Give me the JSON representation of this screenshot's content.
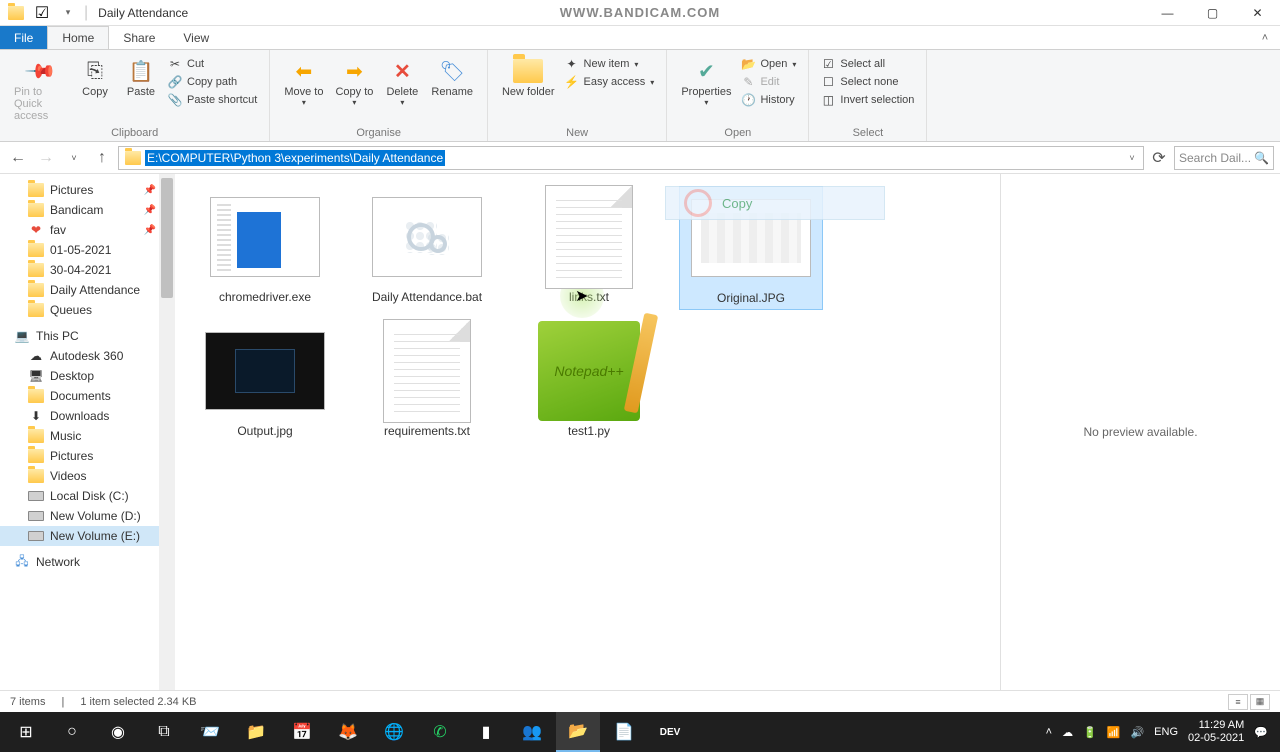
{
  "title": "Daily Attendance",
  "watermark": "WWW.BANDICAM.COM",
  "tabs": {
    "file": "File",
    "home": "Home",
    "share": "Share",
    "view": "View"
  },
  "ribbon": {
    "clipboard": {
      "label": "Clipboard",
      "pin": "Pin to Quick access",
      "copy": "Copy",
      "paste": "Paste",
      "cut": "Cut",
      "copypath": "Copy path",
      "pasteshortcut": "Paste shortcut"
    },
    "organise": {
      "label": "Organise",
      "moveto": "Move to",
      "copyto": "Copy to",
      "delete": "Delete",
      "rename": "Rename"
    },
    "new": {
      "label": "New",
      "newfolder": "New folder",
      "newitem": "New item",
      "easyaccess": "Easy access"
    },
    "open": {
      "label": "Open",
      "properties": "Properties",
      "open": "Open",
      "edit": "Edit",
      "history": "History"
    },
    "select": {
      "label": "Select",
      "selectall": "Select all",
      "selectnone": "Select none",
      "invert": "Invert selection"
    }
  },
  "address": "E:\\COMPUTER\\Python 3\\experiments\\Daily Attendance",
  "search_placeholder": "Search Dail...",
  "nav_items": [
    {
      "label": "Pictures",
      "type": "folder",
      "pinned": true
    },
    {
      "label": "Bandicam",
      "type": "folder",
      "pinned": true
    },
    {
      "label": "fav",
      "type": "heart",
      "pinned": true
    },
    {
      "label": "01-05-2021",
      "type": "folder"
    },
    {
      "label": "30-04-2021",
      "type": "folder"
    },
    {
      "label": "Daily Attendance",
      "type": "folder"
    },
    {
      "label": "Queues",
      "type": "folder"
    }
  ],
  "nav_pc": "This PC",
  "nav_pc_items": [
    {
      "label": "Autodesk 360",
      "type": "cloud"
    },
    {
      "label": "Desktop",
      "type": "desktop"
    },
    {
      "label": "Documents",
      "type": "folder"
    },
    {
      "label": "Downloads",
      "type": "download"
    },
    {
      "label": "Music",
      "type": "folder"
    },
    {
      "label": "Pictures",
      "type": "folder"
    },
    {
      "label": "Videos",
      "type": "folder"
    },
    {
      "label": "Local Disk (C:)",
      "type": "drive"
    },
    {
      "label": "New Volume (D:)",
      "type": "drive"
    },
    {
      "label": "New Volume (E:)",
      "type": "drive",
      "selected": true
    }
  ],
  "nav_network": "Network",
  "files": [
    {
      "name": "chromedriver.exe",
      "thumb": "exe"
    },
    {
      "name": "Daily Attendance.bat",
      "thumb": "bat"
    },
    {
      "name": "links.txt",
      "thumb": "txt"
    },
    {
      "name": "Original.JPG",
      "thumb": "jpg-light",
      "selected": true
    },
    {
      "name": "Output.jpg",
      "thumb": "jpg-dark"
    },
    {
      "name": "requirements.txt",
      "thumb": "txt"
    },
    {
      "name": "test1.py",
      "thumb": "py"
    }
  ],
  "copy_toast": "Copy",
  "preview_msg": "No preview available.",
  "status": {
    "items": "7 items",
    "selected": "1 item selected  2.34 KB"
  },
  "tray": {
    "lang": "ENG",
    "time": "11:29 AM",
    "date": "02-05-2021"
  }
}
